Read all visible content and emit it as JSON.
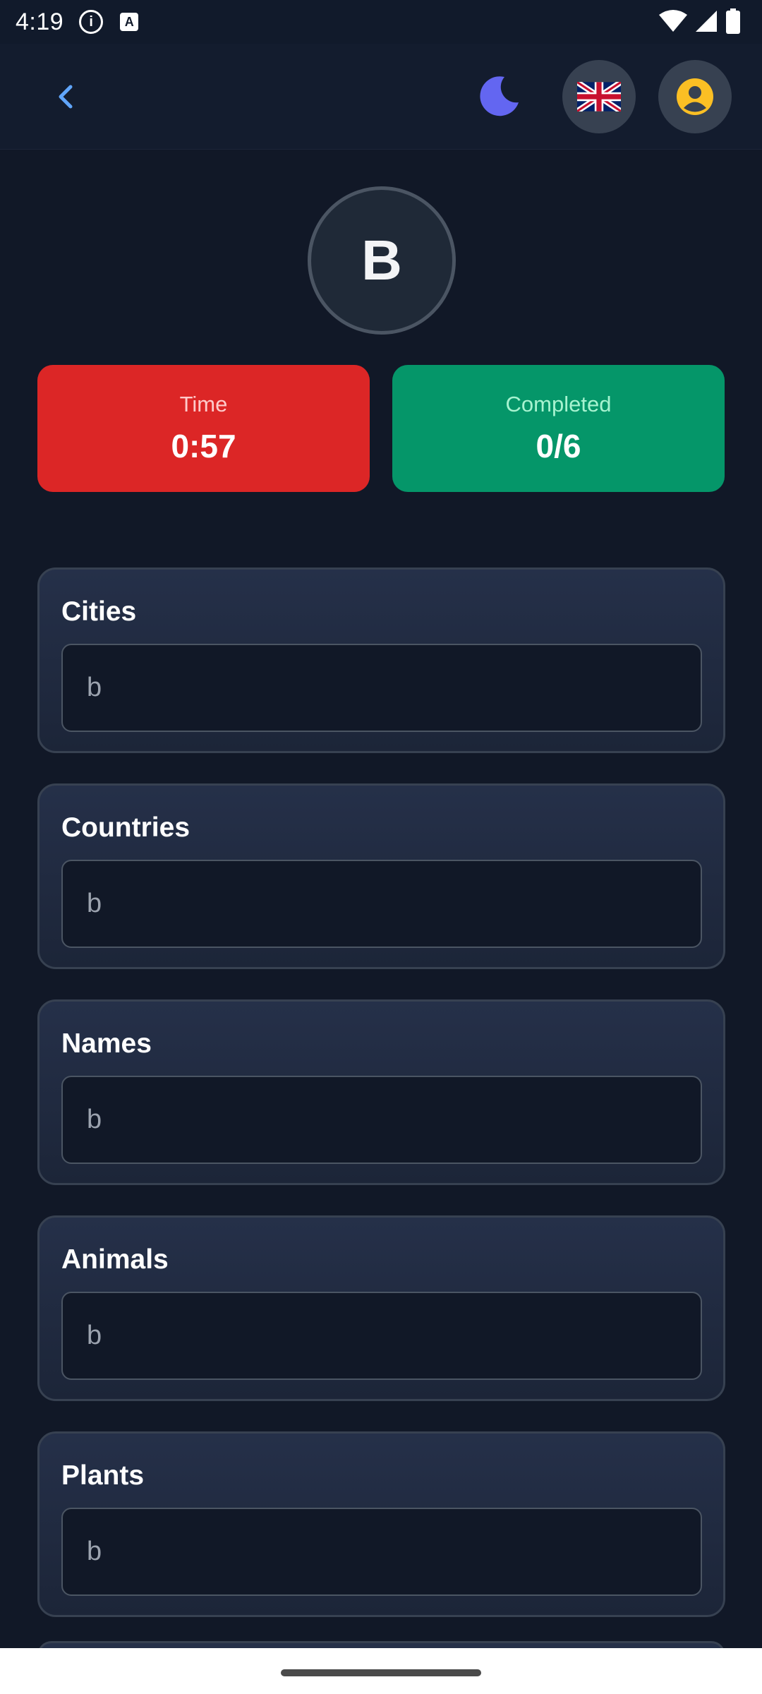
{
  "status_bar": {
    "time": "4:19",
    "info_icon": "info-icon",
    "a_icon_label": "A",
    "wifi_icon": "wifi-icon",
    "signal_icon": "signal-icon",
    "battery_icon": "battery-icon"
  },
  "header": {
    "back_icon": "chevron-left-icon",
    "theme_icon": "moon-icon",
    "language_icon": "uk-flag-icon",
    "profile_icon": "user-circle-icon"
  },
  "game": {
    "letter": "B",
    "time_label": "Time",
    "time_value": "0:57",
    "completed_label": "Completed",
    "completed_value": "0/6"
  },
  "categories": [
    {
      "title": "Cities",
      "placeholder": "b"
    },
    {
      "title": "Countries",
      "placeholder": "b"
    },
    {
      "title": "Names",
      "placeholder": "b"
    },
    {
      "title": "Animals",
      "placeholder": "b"
    },
    {
      "title": "Plants",
      "placeholder": "b"
    }
  ],
  "colors": {
    "background": "#111827",
    "time_card": "#dc2626",
    "completed_card": "#059669",
    "accent_blue": "#60a5fa",
    "moon": "#6366f1",
    "profile_yellow": "#fbbf24"
  }
}
